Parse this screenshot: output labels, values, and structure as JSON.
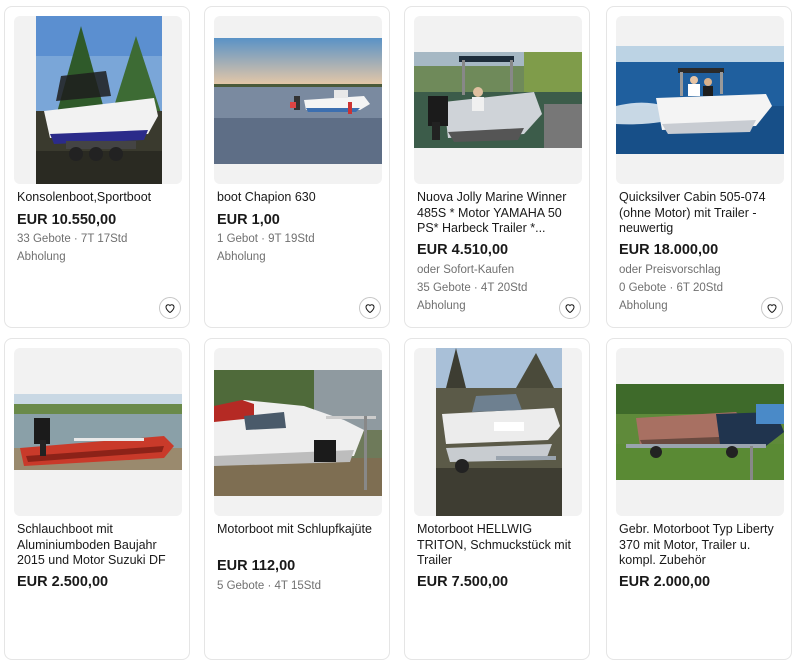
{
  "listings": [
    {
      "title": "Konsolenboot,Sportboot",
      "price": "EUR 10.550,00",
      "bids": "33 Gebote · 7T 17Std",
      "option": "",
      "delivery": "Abholung"
    },
    {
      "title": "boot Chapion 630",
      "price": "EUR 1,00",
      "bids": "1 Gebot · 9T 19Std",
      "option": "",
      "delivery": "Abholung"
    },
    {
      "title": "Nuova Jolly Marine Winner 485S * Motor YAMAHA 50 PS* Harbeck Trailer *...",
      "price": "EUR 4.510,00",
      "option": "oder Sofort-Kaufen",
      "bids": "35 Gebote · 4T 20Std",
      "delivery": "Abholung"
    },
    {
      "title": "Quicksilver Cabin 505-074 (ohne Motor) mit Trailer - neuwertig",
      "price": "EUR 18.000,00",
      "option": "oder Preisvorschlag",
      "bids": "0 Gebote · 6T 20Std",
      "delivery": "Abholung"
    },
    {
      "title": "Schlauchboot mit Aluminiumboden Baujahr 2015 und Motor Suzuki DF 1...",
      "price": "EUR 2.500,00",
      "option": "",
      "bids": "",
      "delivery": ""
    },
    {
      "title": "Motorboot mit Schlupfkajüte",
      "price": "EUR 112,00",
      "option": "",
      "bids": "5 Gebote · 4T 15Std",
      "delivery": ""
    },
    {
      "title": "Motorboot HELLWIG TRITON, Schmuckstück mit Trailer",
      "price": "EUR 7.500,00",
      "option": "",
      "bids": "",
      "delivery": ""
    },
    {
      "title": "Gebr. Motorboot Typ Liberty 370 mit Motor, Trailer u. kompl. Zubehör",
      "price": "EUR 2.000,00",
      "option": "",
      "bids": "",
      "delivery": ""
    }
  ],
  "icons": {
    "watch": "heart-icon"
  },
  "colors": {
    "text": "#191919",
    "meta": "#707070",
    "border": "#e5e5e5"
  }
}
